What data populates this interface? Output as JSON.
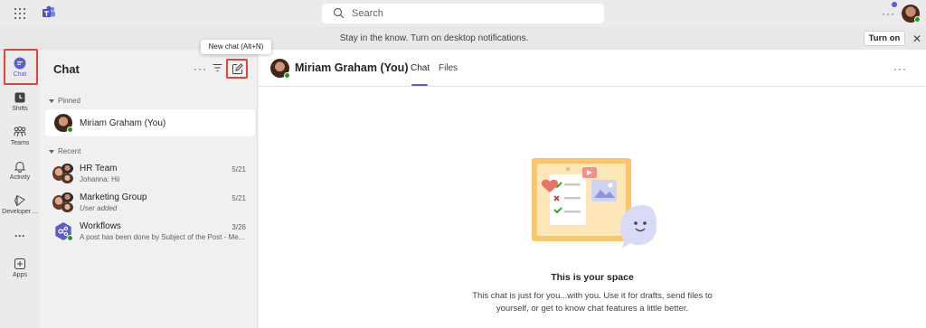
{
  "topbar": {
    "search_placeholder": "Search",
    "more_label": "···",
    "icons": [
      "app-launcher-icon",
      "teams-logo-icon",
      "search-icon"
    ]
  },
  "banner": {
    "text": "Stay in the know. Turn on desktop notifications.",
    "button_label": "Turn on",
    "close_label": "✕"
  },
  "rail": {
    "items": [
      {
        "label": "Chat",
        "icon": "chat-icon",
        "active": true
      },
      {
        "label": "Shifts",
        "icon": "shifts-icon"
      },
      {
        "label": "Teams",
        "icon": "teams-icon"
      },
      {
        "label": "Activity",
        "icon": "bell-icon"
      },
      {
        "label": "Developer ...",
        "icon": "developer-portal-icon"
      },
      {
        "label": "···",
        "icon": "more-apps-icon"
      },
      {
        "label": "Apps",
        "icon": "apps-icon"
      }
    ]
  },
  "chat_pane": {
    "title": "Chat",
    "more_label": "···",
    "new_chat_tooltip": "New chat (Alt+N)",
    "pinned_label": "Pinned",
    "recent_label": "Recent",
    "pinned": [
      {
        "name": "Miriam Graham (You)"
      }
    ],
    "recent": [
      {
        "name": "HR Team",
        "preview": "Johanna: Hii",
        "date": "5/21"
      },
      {
        "name": "Marketing Group",
        "preview": "User added",
        "date": "5/21"
      },
      {
        "name": "Workflows",
        "preview": "A post has been done by Subject of the Post - Me...",
        "date": "3/26"
      }
    ]
  },
  "main": {
    "header_name": "Miriam Graham (You)",
    "tabs": [
      {
        "label": "Chat",
        "active": true
      },
      {
        "label": "Files"
      }
    ],
    "more_label": "···",
    "empty_title": "This is your space",
    "empty_description": "This chat is just for you...with you. Use it for drafts, send files to yourself, or get to know chat features a little better."
  },
  "colors": {
    "accent": "#5b5fc7",
    "highlight_box": "#e0443f",
    "presence_available": "#13a10e"
  }
}
